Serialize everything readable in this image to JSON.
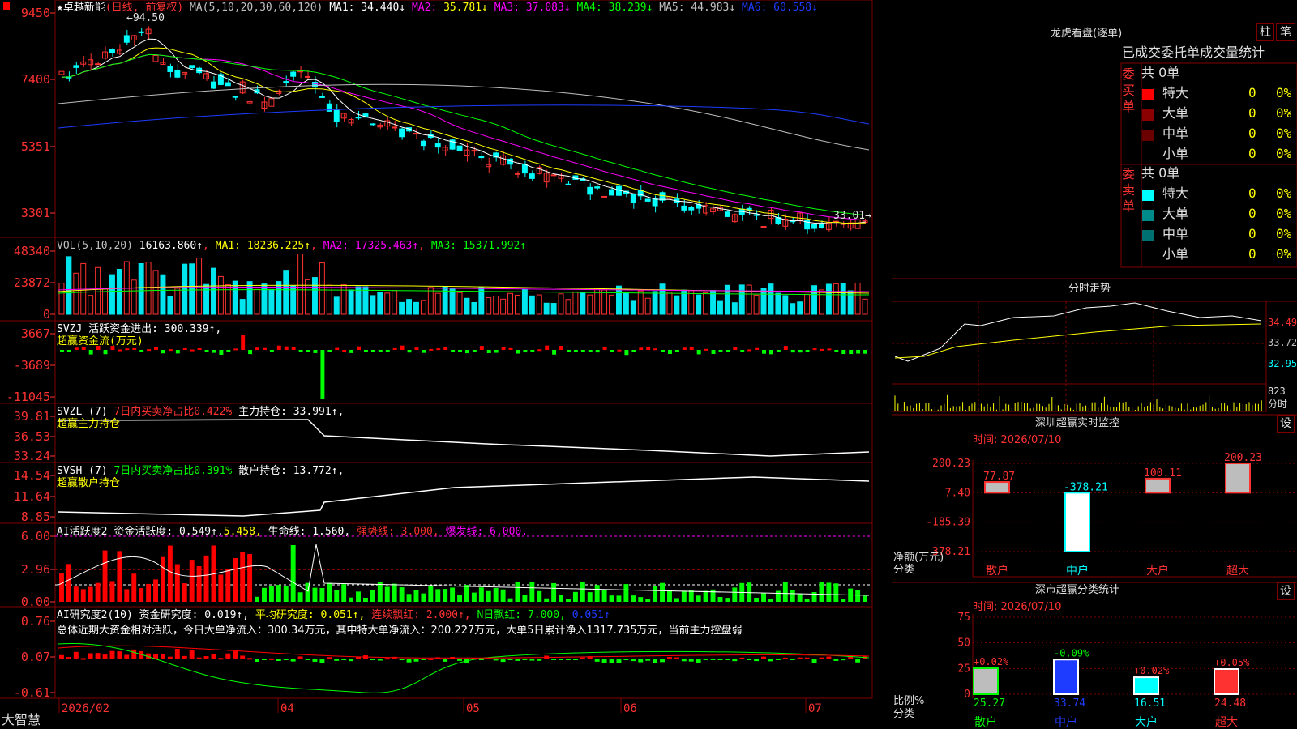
{
  "colors": {
    "up": "#ff3232",
    "down": "#00ffff",
    "vol_down": "#00e5ee",
    "green": "#00ff00",
    "yellow": "#ffff00",
    "magenta": "#ff00ff",
    "white": "#ffffff",
    "gray": "#c0c0c0",
    "blue": "#1e3cff",
    "grid": "#800000",
    "red": "#ff0000"
  },
  "main": {
    "stock_name": "卓越新能",
    "mode": "(日线, 前复权)",
    "ma_label": "MA(5,10,20,30,60,120)",
    "ma": [
      {
        "label": "MA1:",
        "value": "34.440↓",
        "color": "#ffffff"
      },
      {
        "label": "MA2:",
        "value": "35.781↓",
        "color": "#ffff00",
        "label_color": "#ff00ff"
      },
      {
        "label": "MA3:",
        "value": "37.083↓",
        "color": "#ff00ff"
      },
      {
        "label": "MA4:",
        "value": "38.239↓",
        "color": "#00ff00"
      },
      {
        "label": "MA5:",
        "value": "44.983↓",
        "color": "#c0c0c0"
      },
      {
        "label": "MA6:",
        "value": "60.558↓",
        "color": "#1e3cff"
      }
    ],
    "y_ticks": [
      "9450",
      "7400",
      "5351",
      "3301"
    ],
    "high_label": "94.50",
    "low_label": "33.01"
  },
  "vol": {
    "title": "VOL(5,10,20)",
    "value": "16163.860↑",
    "ma1": "MA1: 18236.225↑",
    "ma2": "MA2: 17325.463↑",
    "ma3": "MA3: 15371.992↑",
    "y_ticks": [
      "48340",
      "23872",
      "0"
    ]
  },
  "svzj": {
    "title": "SVZJ",
    "label": "活跃资金进出: 300.339↑,",
    "sub": "超赢资金流(万元)",
    "y_ticks": [
      "3667",
      "-3689",
      "-11045"
    ]
  },
  "svzl": {
    "title": "SVZL (7)",
    "label1": "7日内买卖净占比0.422%",
    "label2": "主力持仓: 33.991↑,",
    "sub": "超赢主力持仓",
    "y_ticks": [
      "39.81",
      "36.53",
      "33.24"
    ]
  },
  "svsh": {
    "title": "SVSH (7)",
    "label1": "7日内买卖净占比0.391%",
    "label2": "散户持仓: 13.772↑,",
    "sub": "超赢散户持仓",
    "y_ticks": [
      "14.54",
      "11.64",
      "8.85"
    ]
  },
  "ai1": {
    "title": "AI活跃度2",
    "label1": "资金活跃度: 0.549↑,",
    "label2": "5.458,",
    "label3": "生命线: 1.560,",
    "label4": "强势线: 3.000,",
    "label5": "爆发线: 6.000,",
    "y_ticks": [
      "6.00",
      "2.96",
      "0.00"
    ]
  },
  "ai2": {
    "title": "AI研究度2(10)",
    "label1": "资金研究度: 0.019↑,",
    "label2": "平均研究度: 0.051↑,",
    "label3": "连续飘红: 2.000↑,",
    "label4": "N日飘红: 7.000,",
    "label5": "0.051↑",
    "comment": "总体近期大资金相对活跃，今日大单净流入：300.34万元，其中特大单净流入：200.227万元，大单5日累计净入1317.735万元，当前主力控盘弱",
    "y_ticks": [
      "0.76",
      "0.07",
      "-0.61"
    ]
  },
  "xaxis": {
    "brand": "大智慧",
    "labels": [
      "2026/02",
      "04",
      "05",
      "06",
      "07"
    ]
  },
  "right": {
    "lhb_title": "龙虎看盘(逐单)",
    "btn1": "柱",
    "btn2": "笔",
    "stats_title": "已成交委托单成交量统计",
    "buy": {
      "side_label": "委买单",
      "total": "共 0单",
      "rows": [
        {
          "name": "特大",
          "count": "0",
          "pct": "0%",
          "color": "#ff0000"
        },
        {
          "name": "大单",
          "count": "0",
          "pct": "0%",
          "color": "#8b0000"
        },
        {
          "name": "中单",
          "count": "0",
          "pct": "0%",
          "color": "#6b0000"
        },
        {
          "name": "小单",
          "count": "0",
          "pct": "0%",
          "color": ""
        }
      ]
    },
    "sell": {
      "side_label": "委卖单",
      "total": "共 0单",
      "rows": [
        {
          "name": "特大",
          "count": "0",
          "pct": "0%",
          "color": "#00ffff"
        },
        {
          "name": "大单",
          "count": "0",
          "pct": "0%",
          "color": "#008b8b"
        },
        {
          "name": "中单",
          "count": "0",
          "pct": "0%",
          "color": "#007070"
        },
        {
          "name": "小单",
          "count": "0",
          "pct": "0%",
          "color": ""
        }
      ]
    },
    "fs_title": "分时走势",
    "fs_y": [
      "34.49",
      "33.72",
      "32.95"
    ],
    "fs_vol": "823",
    "fs_unit": "分时",
    "sz_title": "深圳超赢实时监控",
    "sz_btn": "设",
    "sz_time": "时间: 2026/07/10",
    "sz_y": [
      "200.23",
      "7.40",
      "-185.39",
      "-378.21"
    ],
    "sz_bars": [
      {
        "cat": "散户",
        "value": 77.87,
        "label": "77.87"
      },
      {
        "cat": "中户",
        "value": -378.21,
        "label": "-378.21"
      },
      {
        "cat": "大户",
        "value": 100.11,
        "label": "100.11"
      },
      {
        "cat": "超大",
        "value": 200.23,
        "label": "200.23"
      }
    ],
    "sz_ylabel": "净额(万元)",
    "sz_xlabel": "分类",
    "ss_title": "深市超赢分类统计",
    "ss_btn": "设",
    "ss_time": "时间: 2026/07/10",
    "ss_y": [
      "75",
      "50",
      "25",
      "0"
    ],
    "ss_bars": [
      {
        "cat": "散户",
        "value": 25.27,
        "label": "25.27",
        "chg": "+0.02%"
      },
      {
        "cat": "中户",
        "value": 33.74,
        "label": "33.74",
        "chg": "-0.09%"
      },
      {
        "cat": "大户",
        "value": 16.51,
        "label": "16.51",
        "chg": "+0.02%"
      },
      {
        "cat": "超大",
        "value": 24.48,
        "label": "24.48",
        "chg": "+0.05%"
      }
    ],
    "ss_ylabel": "比例%",
    "ss_xlabel": "分类"
  }
}
